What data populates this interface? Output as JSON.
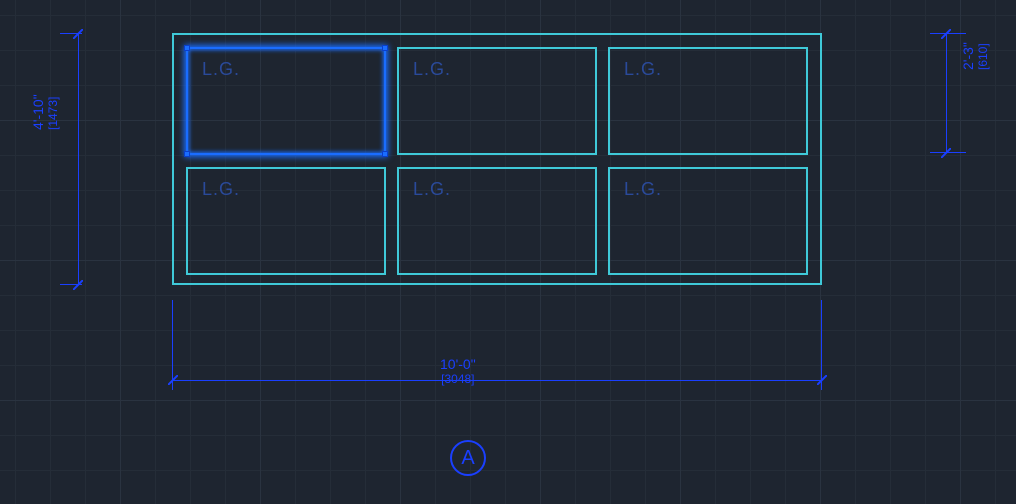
{
  "drawing": {
    "panes": [
      {
        "label": "L.G.",
        "selected": true
      },
      {
        "label": "L.G.",
        "selected": false
      },
      {
        "label": "L.G.",
        "selected": false
      },
      {
        "label": "L.G.",
        "selected": false
      },
      {
        "label": "L.G.",
        "selected": false
      },
      {
        "label": "L.G.",
        "selected": false
      }
    ],
    "dimensions": {
      "height": {
        "imperial": "4'-10\"",
        "metric": "[1473]"
      },
      "width": {
        "imperial": "10'-0\"",
        "metric": "[3048]"
      },
      "pane_height": {
        "imperial": "2'-3\"",
        "metric": "[610]"
      }
    },
    "elevation_tag": "A"
  },
  "chart_data": {
    "type": "diagram",
    "description": "CAD elevation drawing of a storefront/window unit containing a 3×2 grid of glazed panes, each labeled L.G. (laminated glass). The top-left pane is currently selected (highlighted blue). Overall dimensions shown: width 10'-0\" [3048], height 4'-10\" [1473]; single pane height approx 2'-3\" [610]. Elevation tag circle labeled A below.",
    "overall_width_in": 120,
    "overall_width_mm": 3048,
    "overall_height_mm": 1473,
    "pane_rows": 2,
    "pane_cols": 3,
    "pane_label": "L.G.",
    "elevation": "A"
  }
}
